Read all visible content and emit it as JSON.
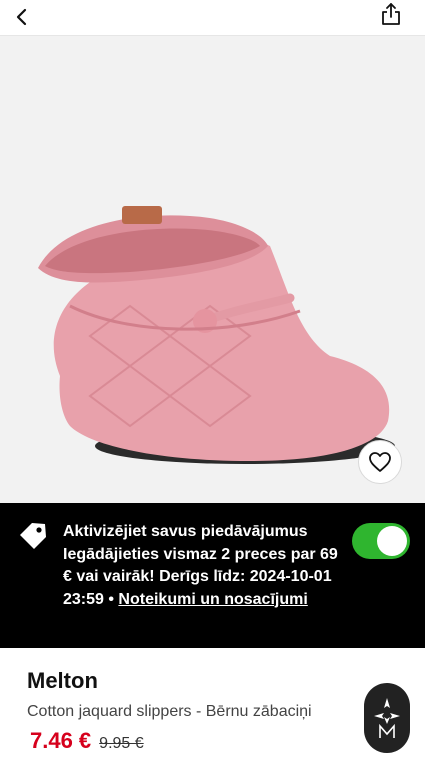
{
  "header": {
    "back_icon": "chevron-left-icon",
    "share_icon": "share-icon"
  },
  "gallery": {
    "image_description_icon": "pink-baby-slipper-image",
    "dot_count": 5,
    "active_dot": 0,
    "wishlist_icon": "heart-icon"
  },
  "promo": {
    "tag_icon": "price-tag-icon",
    "text": "Aktivizējiet savus piedāvājumus Iegādājieties vismaz 2 preces par 69 € vai vairāk! Derīgs līdz: 2024-10-01 23:59 • ",
    "link_text": "Noteikumi un nosacījumi",
    "toggle_on": true,
    "toggle_color": "#2fb52f"
  },
  "product": {
    "brand": "Melton",
    "title": "Cotton jaquard slippers - Bērnu zābaciņi",
    "price": "7.46 €",
    "old_price": "9.95 €",
    "price_color": "#d6001c",
    "brand_logo_icon": "brand-logo-icon"
  }
}
